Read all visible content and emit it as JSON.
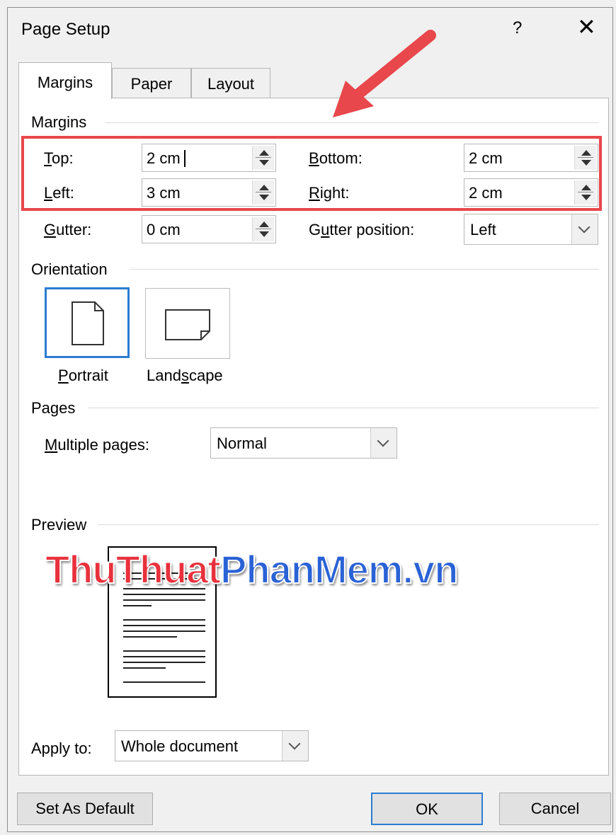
{
  "dialog": {
    "title": "Page Setup",
    "help": "?",
    "close": "✕"
  },
  "tabs": [
    {
      "label": "Margins",
      "active": true
    },
    {
      "label": "Paper",
      "active": false
    },
    {
      "label": "Layout",
      "active": false
    }
  ],
  "margins": {
    "section": "Margins",
    "top_label": "Top:",
    "top_value": "2 cm",
    "bottom_label": "Bottom:",
    "bottom_value": "2 cm",
    "left_label": "Left:",
    "left_value": "3 cm",
    "right_label": "Right:",
    "right_value": "2 cm",
    "gutter_label": "Gutter:",
    "gutter_value": "0 cm",
    "gutter_position_label": "Gutter position:",
    "gutter_position_value": "Left"
  },
  "orientation": {
    "section": "Orientation",
    "portrait_label": "Portrait",
    "landscape_label": "Landscape",
    "selected": "portrait"
  },
  "pages": {
    "section": "Pages",
    "multiple_pages_label": "Multiple pages:",
    "multiple_pages_value": "Normal"
  },
  "preview": {
    "section": "Preview"
  },
  "apply": {
    "label": "Apply to:",
    "value": "Whole document"
  },
  "buttons": {
    "set_default": "Set As Default",
    "ok": "OK",
    "cancel": "Cancel"
  },
  "watermark": {
    "part1": "ThuThuat",
    "part2": "PhanMem.vn"
  },
  "colors": {
    "highlight_red": "#e8474c",
    "arrow_red": "#e8474c",
    "focus_blue": "#2b7cd3"
  }
}
